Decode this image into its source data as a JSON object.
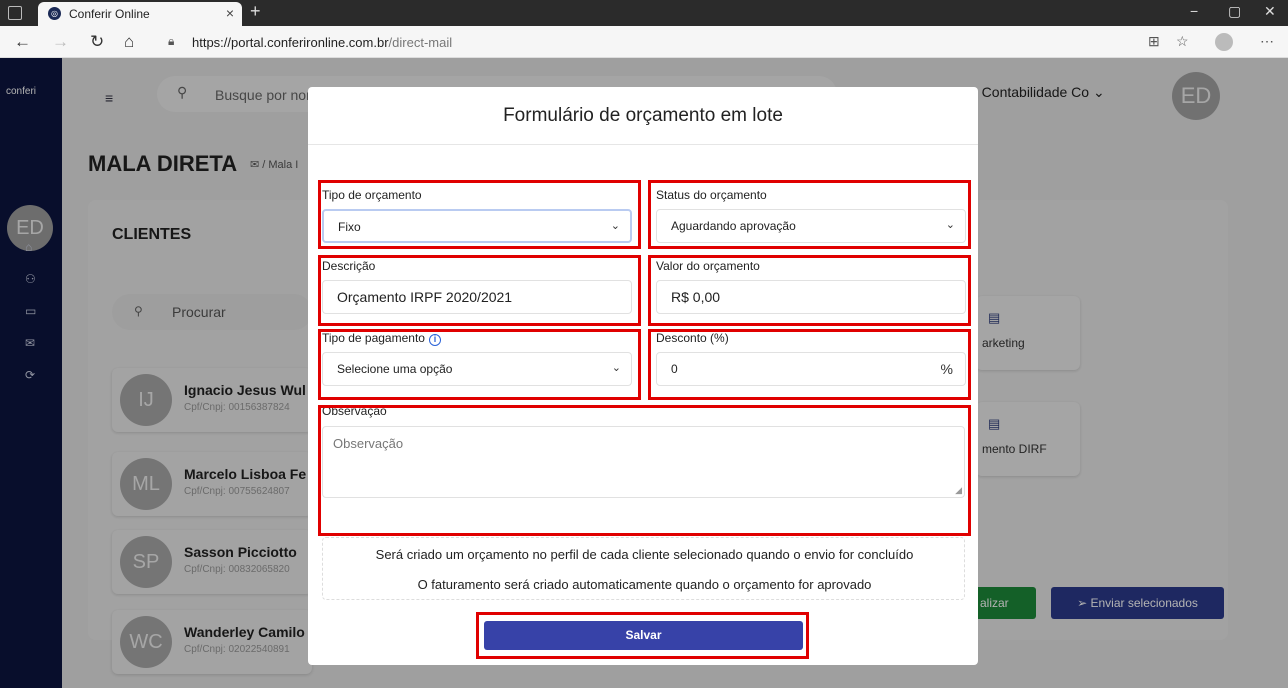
{
  "browser": {
    "tab_title": "Conferir Online",
    "tab_close": "×",
    "new_tab": "+",
    "url_host": "https://portal.conferironline.com.br",
    "url_path": "/direct-mail",
    "window_controls": [
      "−",
      "▢",
      "✕"
    ]
  },
  "app": {
    "logo_text": "conferi",
    "sidebar_avatar": "ED",
    "search_placeholder": "Busque por nor",
    "company_selector": "e Contabilidade Co",
    "top_avatar": "ED",
    "page_title": "MALA DIRETA",
    "breadcrumb": "/ Mala I",
    "clients_title": "CLIENTES",
    "clients_search_placeholder": "Procurar",
    "clients": [
      {
        "initials": "IJ",
        "name": "Ignacio Jesus Wul",
        "doc": "Cpf/Cnpj: 00156387824"
      },
      {
        "initials": "ML",
        "name": "Marcelo Lisboa Fe",
        "doc": "Cpf/Cnpj: 00755624807"
      },
      {
        "initials": "SP",
        "name": "Sasson Picciotto",
        "doc": "Cpf/Cnpj: 00832065820"
      },
      {
        "initials": "WC",
        "name": "Wanderley Camilo",
        "doc": "Cpf/Cnpj: 02022540891"
      }
    ],
    "templates": [
      {
        "label": "arketing"
      },
      {
        "label": "mento DIRF"
      }
    ],
    "finalize_button": "alizar",
    "send_selected_button": "Enviar selecionados"
  },
  "modal": {
    "title": "Formulário de orçamento em lote",
    "tipo_orcamento": {
      "label": "Tipo de orçamento",
      "value": "Fixo"
    },
    "status_orcamento": {
      "label": "Status do orçamento",
      "value": "Aguardando aprovação"
    },
    "descricao": {
      "label": "Descrição",
      "value": "Orçamento IRPF 2020/2021"
    },
    "valor_orcamento": {
      "label": "Valor do orçamento",
      "value": "R$ 0,00"
    },
    "tipo_pagamento": {
      "label": "Tipo de pagamento",
      "value": "Selecione uma opção"
    },
    "desconto": {
      "label": "Desconto (%)",
      "value": "0",
      "unit": "%"
    },
    "observacao": {
      "label": "Observação",
      "placeholder": "Observação"
    },
    "info_lines": [
      "Será criado um orçamento no perfil de cada cliente selecionado quando o envio for concluído",
      "O faturamento será criado automaticamente quando o orçamento for aprovado"
    ],
    "save_button": "Salvar"
  },
  "colors": {
    "sidebar": "#0c1540",
    "primary_button": "#3742a8",
    "highlight": "#e00000",
    "green_button": "#1e8a3a"
  }
}
